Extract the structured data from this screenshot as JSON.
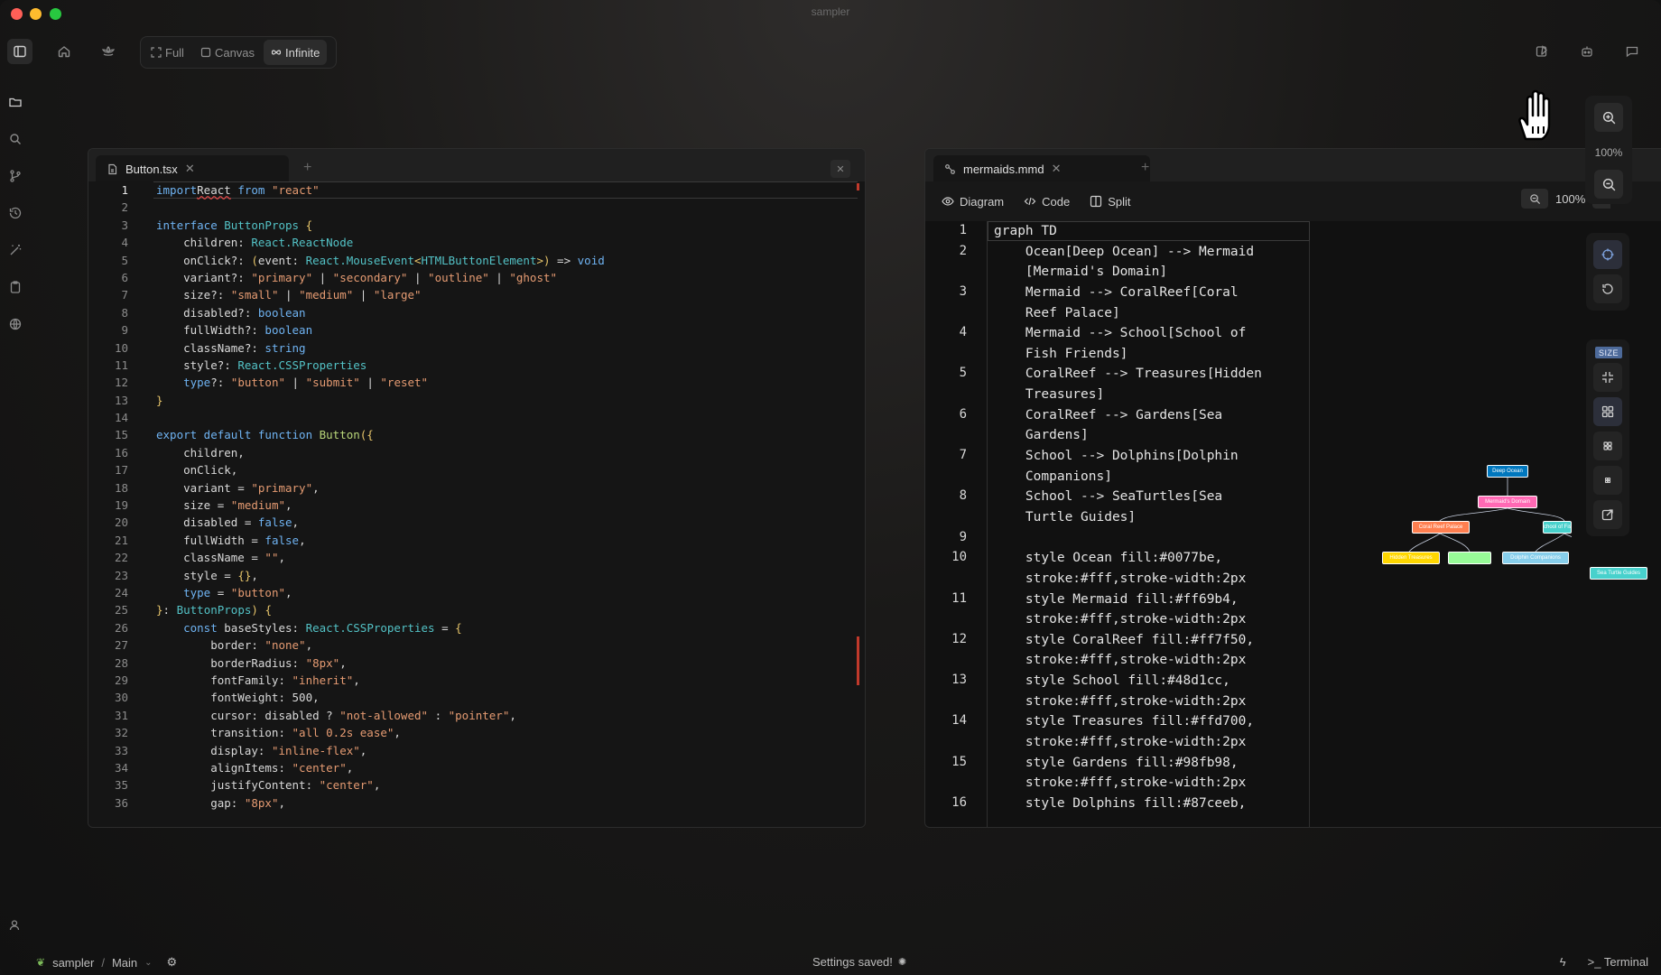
{
  "window": {
    "title": "sampler"
  },
  "toolbar": {
    "modes": [
      {
        "label": "Full",
        "icon": "expand-icon",
        "active": false
      },
      {
        "label": "Canvas",
        "icon": "square-icon",
        "active": false
      },
      {
        "label": "Infinite",
        "icon": "infinity-icon",
        "active": true
      }
    ]
  },
  "left_editor": {
    "tab_label": "Button.tsx",
    "lines": [
      [
        [
          "kw",
          "import"
        ],
        [
          "",
          "React"
        ],
        [
          "kw",
          " from"
        ],
        [
          "st",
          " \"react\""
        ]
      ],
      [],
      [
        [
          "kw",
          "interface"
        ],
        [
          "ty",
          " ButtonProps"
        ],
        [
          "br",
          " {"
        ]
      ],
      [
        [
          "",
          "    children: "
        ],
        [
          "ty",
          "React.ReactNode"
        ]
      ],
      [
        [
          "",
          "    onClick?: "
        ],
        [
          "br",
          "("
        ],
        [
          "",
          "event: "
        ],
        [
          "ty",
          "React.MouseEvent"
        ],
        [
          "br",
          "<"
        ],
        [
          "ty",
          "HTMLButtonElement"
        ],
        [
          "br",
          ">"
        ],
        [
          "br",
          ")"
        ],
        [
          "",
          " => "
        ],
        [
          "kw",
          "void"
        ]
      ],
      [
        [
          "",
          "    variant?: "
        ],
        [
          "st",
          "\"primary\""
        ],
        [
          "",
          " | "
        ],
        [
          "st",
          "\"secondary\""
        ],
        [
          "",
          " | "
        ],
        [
          "st",
          "\"outline\""
        ],
        [
          "",
          " | "
        ],
        [
          "st",
          "\"ghost\""
        ]
      ],
      [
        [
          "",
          "    size?: "
        ],
        [
          "st",
          "\"small\""
        ],
        [
          "",
          " | "
        ],
        [
          "st",
          "\"medium\""
        ],
        [
          "",
          " | "
        ],
        [
          "st",
          "\"large\""
        ]
      ],
      [
        [
          "",
          "    disabled?: "
        ],
        [
          "kw",
          "boolean"
        ]
      ],
      [
        [
          "",
          "    fullWidth?: "
        ],
        [
          "kw",
          "boolean"
        ]
      ],
      [
        [
          "",
          "    className?: "
        ],
        [
          "kw",
          "string"
        ]
      ],
      [
        [
          "",
          "    style?: "
        ],
        [
          "ty",
          "React.CSSProperties"
        ]
      ],
      [
        [
          "",
          "    "
        ],
        [
          "kw",
          "type"
        ],
        [
          "",
          "?: "
        ],
        [
          "st",
          "\"button\""
        ],
        [
          "",
          " | "
        ],
        [
          "st",
          "\"submit\""
        ],
        [
          "",
          " | "
        ],
        [
          "st",
          "\"reset\""
        ]
      ],
      [
        [
          "br",
          "}"
        ]
      ],
      [],
      [
        [
          "kw",
          "export default function"
        ],
        [
          "fn",
          " Button"
        ],
        [
          "br",
          "({"
        ]
      ],
      [
        [
          "",
          "    children,"
        ]
      ],
      [
        [
          "",
          "    onClick,"
        ]
      ],
      [
        [
          "",
          "    variant = "
        ],
        [
          "st",
          "\"primary\""
        ],
        [
          "",
          ","
        ]
      ],
      [
        [
          "",
          "    size = "
        ],
        [
          "st",
          "\"medium\""
        ],
        [
          "",
          ","
        ]
      ],
      [
        [
          "",
          "    disabled = "
        ],
        [
          "kw",
          "false"
        ],
        [
          "",
          ","
        ]
      ],
      [
        [
          "",
          "    fullWidth = "
        ],
        [
          "kw",
          "false"
        ],
        [
          "",
          ","
        ]
      ],
      [
        [
          "",
          "    className = "
        ],
        [
          "st",
          "\"\""
        ],
        [
          "",
          ","
        ]
      ],
      [
        [
          "",
          "    style = "
        ],
        [
          "br",
          "{}"
        ],
        [
          "",
          ","
        ]
      ],
      [
        [
          "",
          "    "
        ],
        [
          "kw",
          "type"
        ],
        [
          "",
          " = "
        ],
        [
          "st",
          "\"button\""
        ],
        [
          "",
          ","
        ]
      ],
      [
        [
          "br",
          "}"
        ],
        [
          "",
          ": "
        ],
        [
          "ty",
          "ButtonProps"
        ],
        [
          "br",
          ")"
        ],
        [
          "",
          " "
        ],
        [
          "br",
          "{"
        ]
      ],
      [
        [
          "",
          "    "
        ],
        [
          "kw",
          "const"
        ],
        [
          "",
          " baseStyles: "
        ],
        [
          "ty",
          "React.CSSProperties"
        ],
        [
          "",
          " = "
        ],
        [
          "br",
          "{"
        ]
      ],
      [
        [
          "",
          "        border: "
        ],
        [
          "st",
          "\"none\""
        ],
        [
          "",
          ","
        ]
      ],
      [
        [
          "",
          "        borderRadius: "
        ],
        [
          "st",
          "\"8px\""
        ],
        [
          "",
          ","
        ]
      ],
      [
        [
          "",
          "        fontFamily: "
        ],
        [
          "st",
          "\"inherit\""
        ],
        [
          "",
          ","
        ]
      ],
      [
        [
          "",
          "        fontWeight: 500,"
        ]
      ],
      [
        [
          "",
          "        cursor: disabled ? "
        ],
        [
          "st",
          "\"not-allowed\""
        ],
        [
          "",
          " : "
        ],
        [
          "st",
          "\"pointer\""
        ],
        [
          "",
          ","
        ]
      ],
      [
        [
          "",
          "        transition: "
        ],
        [
          "st",
          "\"all 0.2s ease\""
        ],
        [
          "",
          ","
        ]
      ],
      [
        [
          "",
          "        display: "
        ],
        [
          "st",
          "\"inline-flex\""
        ],
        [
          "",
          ","
        ]
      ],
      [
        [
          "",
          "        alignItems: "
        ],
        [
          "st",
          "\"center\""
        ],
        [
          "",
          ","
        ]
      ],
      [
        [
          "",
          "        justifyContent: "
        ],
        [
          "st",
          "\"center\""
        ],
        [
          "",
          ","
        ]
      ],
      [
        [
          "",
          "        gap: "
        ],
        [
          "st",
          "\"8px\""
        ],
        [
          "",
          ","
        ]
      ]
    ]
  },
  "right_editor": {
    "tab_label": "mermaids.mmd",
    "view_buttons": [
      "Diagram",
      "Code",
      "Split"
    ],
    "zoom_label": "100%",
    "lines": [
      {
        "n": "1",
        "rows": [
          "graph TD"
        ]
      },
      {
        "n": "2",
        "rows": [
          "    Ocean[Deep Ocean] --> Mermaid",
          "    [Mermaid's Domain]"
        ]
      },
      {
        "n": "3",
        "rows": [
          "    Mermaid --> CoralReef[Coral",
          "    Reef Palace]"
        ]
      },
      {
        "n": "4",
        "rows": [
          "    Mermaid --> School[School of",
          "    Fish Friends]"
        ]
      },
      {
        "n": "5",
        "rows": [
          "    CoralReef --> Treasures[Hidden",
          "    Treasures]"
        ]
      },
      {
        "n": "6",
        "rows": [
          "    CoralReef --> Gardens[Sea",
          "    Gardens]"
        ]
      },
      {
        "n": "7",
        "rows": [
          "    School --> Dolphins[Dolphin",
          "    Companions]"
        ]
      },
      {
        "n": "8",
        "rows": [
          "    School --> SeaTurtles[Sea",
          "    Turtle Guides]"
        ]
      },
      {
        "n": "9",
        "rows": [
          ""
        ]
      },
      {
        "n": "10",
        "rows": [
          "    style Ocean fill:#0077be,",
          "    stroke:#fff,stroke-width:2px"
        ]
      },
      {
        "n": "11",
        "rows": [
          "    style Mermaid fill:#ff69b4,",
          "    stroke:#fff,stroke-width:2px"
        ]
      },
      {
        "n": "12",
        "rows": [
          "    style CoralReef fill:#ff7f50,",
          "    stroke:#fff,stroke-width:2px"
        ]
      },
      {
        "n": "13",
        "rows": [
          "    style School fill:#48d1cc,",
          "    stroke:#fff,stroke-width:2px"
        ]
      },
      {
        "n": "14",
        "rows": [
          "    style Treasures fill:#ffd700,",
          "    stroke:#fff,stroke-width:2px"
        ]
      },
      {
        "n": "15",
        "rows": [
          "    style Gardens fill:#98fb98,",
          "    stroke:#fff,stroke-width:2px"
        ]
      },
      {
        "n": "16",
        "rows": [
          "    style Dolphins fill:#87ceeb,"
        ]
      }
    ],
    "diagram_nodes": [
      {
        "key": "ocean",
        "label": "Deep Ocean",
        "fill": "#0077be"
      },
      {
        "key": "mermaid",
        "label": "Mermaid's Domain",
        "fill": "#ff69b4"
      },
      {
        "key": "coral",
        "label": "Coral Reef Palace",
        "fill": "#ff7f50"
      },
      {
        "key": "school",
        "label": "School of Fish",
        "fill": "#48d1cc"
      },
      {
        "key": "treasures",
        "label": "Hidden Treasures",
        "fill": "#ffd700"
      },
      {
        "key": "gardens",
        "label": "",
        "fill": "#98fb98"
      },
      {
        "key": "dolphins",
        "label": "Dolphin Companions",
        "fill": "#87ceeb"
      },
      {
        "key": "turtles",
        "label": "Sea Turtle Guides",
        "fill": "#48d1cc"
      }
    ]
  },
  "canvas_zoom": {
    "label": "100%"
  },
  "size_panel": {
    "label": "SIZE"
  },
  "statusbar": {
    "project": "sampler",
    "separator": "/",
    "branch": "Main",
    "message": "Settings saved!",
    "terminal_label": "Terminal"
  }
}
